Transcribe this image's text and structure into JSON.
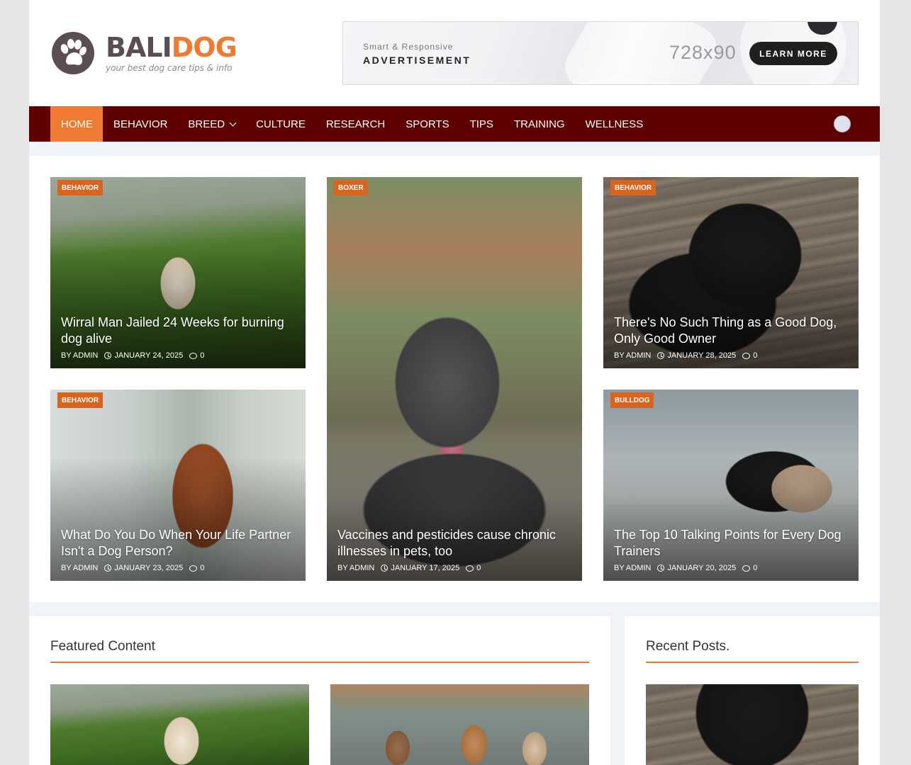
{
  "logo": {
    "name_part1": "BALI",
    "name_part2": "DOG",
    "tagline": "your best dog care tips & info",
    "icon": "paw-print-icon"
  },
  "ad": {
    "small": "Smart & Responsive",
    "big": "ADVERTISEMENT",
    "size": "728x90",
    "button": "LEARN MORE"
  },
  "nav": {
    "items": [
      {
        "label": "HOME",
        "active": true
      },
      {
        "label": "BEHAVIOR"
      },
      {
        "label": "BREED",
        "dropdown": true
      },
      {
        "label": "CULTURE"
      },
      {
        "label": "RESEARCH"
      },
      {
        "label": "SPORTS"
      },
      {
        "label": "TIPS"
      },
      {
        "label": "TRAINING"
      },
      {
        "label": "WELLNESS"
      }
    ],
    "search_icon": "search-icon"
  },
  "posts": [
    {
      "tag": "BEHAVIOR",
      "title": "Wirral Man Jailed 24 Weeks for burning dog alive",
      "author": "BY ADMIN",
      "date": "JANUARY 24, 2025",
      "comments": "0"
    },
    {
      "tag": "BOXER",
      "title": "Vaccines and pesticides cause chronic illnesses in pets, too",
      "author": "BY ADMIN",
      "date": "JANUARY 17, 2025",
      "comments": "0"
    },
    {
      "tag": "BEHAVIOR",
      "title": "There's No Such Thing as a Good Dog, Only Good Owner",
      "author": "BY ADMIN",
      "date": "JANUARY 28, 2025",
      "comments": "0"
    },
    {
      "tag": "BEHAVIOR",
      "title": "What Do You Do When Your Life Partner Isn't a Dog Person?",
      "author": "BY ADMIN",
      "date": "JANUARY 23, 2025",
      "comments": "0"
    },
    {
      "tag": "BULLDOG",
      "title": "The Top 10 Talking Points for Every Dog Trainers",
      "author": "BY ADMIN",
      "date": "JANUARY 20, 2025",
      "comments": "0"
    }
  ],
  "sections": {
    "featured": "Featured Content",
    "recent": "Recent Posts."
  },
  "colors": {
    "nav_bg": "#5f0000",
    "accent": "#ee7b31",
    "tag_bg": "#d9641e"
  }
}
